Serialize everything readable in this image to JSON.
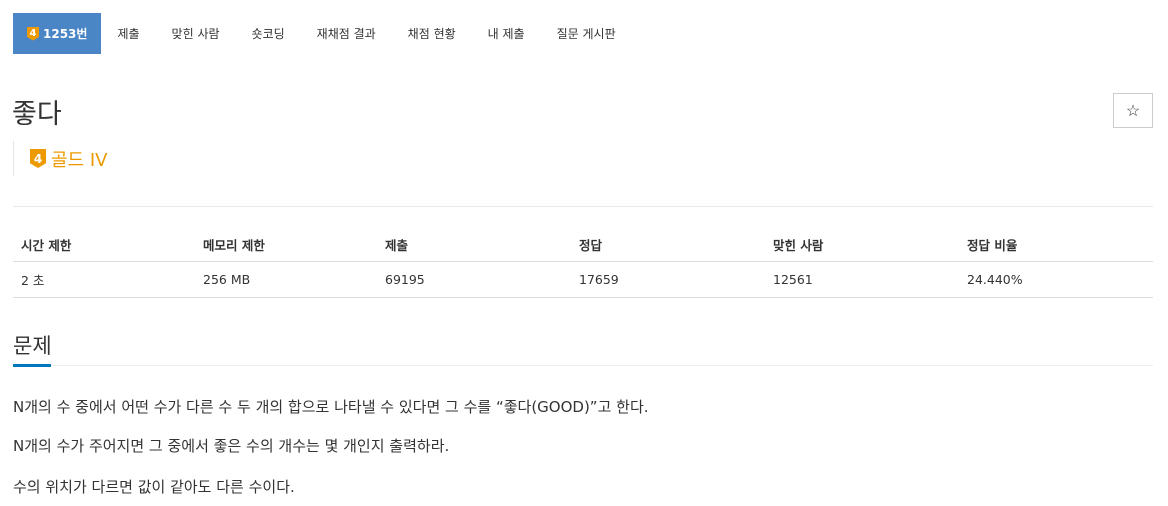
{
  "tabs": [
    {
      "label": "1253번",
      "badge": "4",
      "active": true
    },
    {
      "label": "제출"
    },
    {
      "label": "맞힌 사람"
    },
    {
      "label": "숏코딩"
    },
    {
      "label": "재채점 결과"
    },
    {
      "label": "채점 현황"
    },
    {
      "label": "내 제출"
    },
    {
      "label": "질문 게시판"
    }
  ],
  "problem": {
    "title": "좋다",
    "star_icon": "☆",
    "tier_badge": "4",
    "tier_label": "골드 IV",
    "tier_color": "#ec9a00"
  },
  "info": {
    "headers": [
      "시간 제한",
      "메모리 제한",
      "제출",
      "정답",
      "맞힌 사람",
      "정답 비율"
    ],
    "values": [
      "2 초",
      "256 MB",
      "69195",
      "17659",
      "12561",
      "24.440%"
    ]
  },
  "section": {
    "title": "문제",
    "paragraphs": [
      "N개의 수 중에서 어떤 수가 다른 수 두 개의 합으로 나타낼 수 있다면 그 수를 “좋다(GOOD)”고 한다.",
      "N개의 수가 주어지면 그 중에서 좋은 수의 개수는 몇 개인지 출력하라.",
      "수의 위치가 다르면 값이 같아도 다른 수이다."
    ]
  },
  "colors": {
    "accent": "#4a86c5",
    "gold": "#ec9a00",
    "underline": "#0076c0"
  }
}
